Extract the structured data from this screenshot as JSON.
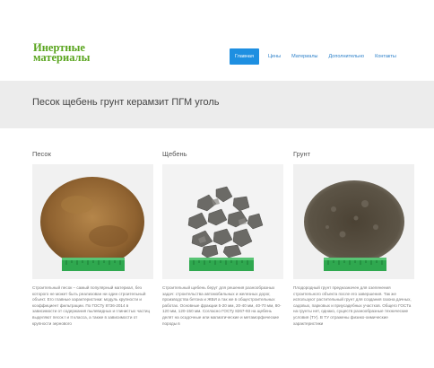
{
  "logo": {
    "line1": "Инертные",
    "line2": "материалы"
  },
  "nav": {
    "items": [
      "Главная",
      "Цены",
      "Материалы",
      "Дополнительно",
      "Контакты"
    ]
  },
  "banner": {
    "title": "Песок щебень грунт керамзит ПГМ уголь"
  },
  "products": [
    {
      "title": "Песок",
      "description": "Строительный песок – самый популярный материал, без которого не может быть реализован ни один строительный объект. Его главные характеристики: модуль крупности и коэффициент фильтрации. По ГОСТу 8736-2014 в зависимости от содержания пылевидных и глинистых частиц выделяют песок I и II класса, а также в зависимости от крупности зернового"
    },
    {
      "title": "Щебень",
      "description": "Строительный щебень берут для решения разнообразных задач: строительства автомобильных и железных дорог, производства бетона и ЖБИ а так же в общестроительных работах. Основные фракции 5-20 мм, 20-40 мм, 40-70 мм, 80-120 мм, 120-150 мм. Согласно ГОСТу 8267-93 на щебень делят на осадочные или магматические и метаморфические породы в"
    },
    {
      "title": "Грунт",
      "description": "Плодородный грунт предназначен для озеленения строительного объекта после его завершения. Так же используют растительный грунт для создания газона дачных, садовых, парковых и приусадебных участков. Общего ГОСТа на грунты нет, однако, существ разнообразные технические условия (ТУ). В ТУ отражены физико-химические характеристики"
    }
  ],
  "colors": {
    "logo": "#5aa51f",
    "nav_active_bg": "#1e8fe1",
    "nav_link": "#2a7fc9",
    "banner_bg": "#ececec",
    "ruler": "#2fa84f"
  }
}
